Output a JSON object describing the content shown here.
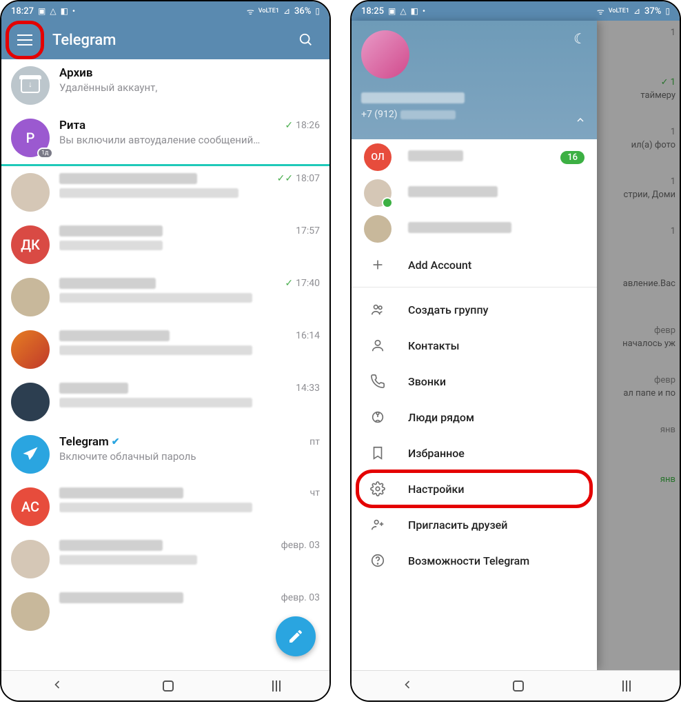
{
  "left": {
    "status": {
      "time": "18:27",
      "battery": "36%"
    },
    "header": {
      "title": "Telegram"
    },
    "chats": [
      {
        "name": "Архив",
        "msg": "Удалённый аккаунт,",
        "time": "",
        "avatar": "archive",
        "checks": 0
      },
      {
        "name": "Рита",
        "msg": "Вы включили автоудаление сообщений…",
        "time": "18:26",
        "avatar": "P",
        "avclass": "av-purple",
        "checks": 1,
        "badge1d": true
      },
      {
        "name": "",
        "msg": "",
        "time": "18:07",
        "avatar": "",
        "avclass": "av-pix",
        "checks": 2,
        "blurred": true,
        "nw": 200,
        "mw": 260
      },
      {
        "name": "",
        "msg": "",
        "time": "17:57",
        "avatar": "ДК",
        "avclass": "av-red",
        "checks": 0,
        "blurred": true,
        "nw": 150,
        "mw": 150
      },
      {
        "name": "",
        "msg": "",
        "time": "17:40",
        "avatar": "",
        "avclass": "av-pix2",
        "checks": 1,
        "blurred": true,
        "nw": 140,
        "mw": 280
      },
      {
        "name": "",
        "msg": "",
        "time": "16:14",
        "avatar": "",
        "avclass": "av-grad",
        "checks": 0,
        "blurred": true,
        "nw": 160,
        "mw": 280
      },
      {
        "name": "",
        "msg": "",
        "time": "14:33",
        "avatar": "",
        "avclass": "av-dark",
        "checks": 0,
        "blurred": true,
        "nw": 100,
        "mw": 280
      },
      {
        "name": "Telegram",
        "msg": "Включите облачный пароль",
        "time": "пт",
        "avatar": "tg",
        "avclass": "av-tg",
        "checks": 0,
        "verified": true
      },
      {
        "name": "",
        "msg": "",
        "time": "чт",
        "avatar": "АС",
        "avclass": "av-orange",
        "checks": 0,
        "blurred": true,
        "nw": 180,
        "mw": 280
      },
      {
        "name": "",
        "msg": "",
        "time": "февр. 03",
        "avatar": "",
        "avclass": "av-pix",
        "checks": 0,
        "blurred": true,
        "nw": 150,
        "mw": 200
      },
      {
        "name": "",
        "msg": "",
        "time": "февр. 03",
        "avatar": "",
        "avclass": "av-pix2",
        "checks": 0,
        "blurred": true,
        "nw": 180,
        "mw": 0
      }
    ]
  },
  "right": {
    "status": {
      "time": "18:25",
      "battery": "37%"
    },
    "phone_prefix": "+7 (912)",
    "accounts": [
      {
        "label": "",
        "avtext": "ОЛ",
        "avclass": "av-orange",
        "badge": "16",
        "blurred": true,
        "bw": 80
      },
      {
        "label": "",
        "avtext": "",
        "avclass": "av-pix",
        "blurred": true,
        "bw": 130,
        "online": true
      },
      {
        "label": "",
        "avtext": "",
        "avclass": "av-pix2",
        "blurred": true,
        "bw": 150
      }
    ],
    "add_account": "Add Account",
    "menu": [
      {
        "label": "Создать группу",
        "icon": "group"
      },
      {
        "label": "Контакты",
        "icon": "contact"
      },
      {
        "label": "Звонки",
        "icon": "call"
      },
      {
        "label": "Люди рядом",
        "icon": "nearby"
      },
      {
        "label": "Избранное",
        "icon": "bookmark"
      },
      {
        "label": "Настройки",
        "icon": "settings",
        "highlight": true
      },
      {
        "label": "Пригласить друзей",
        "icon": "invite"
      },
      {
        "label": "Возможности Telegram",
        "icon": "help"
      }
    ],
    "bg_rows": [
      {
        "time": "1",
        "txt": ""
      },
      {
        "time": "✓ 1",
        "txt": "таймеру",
        "green": true
      },
      {
        "time": "1",
        "txt": "ил(а) фото"
      },
      {
        "time": "1",
        "txt": "стрии, Доми"
      },
      {
        "time": "1",
        "txt": ""
      },
      {
        "time": "",
        "txt": "авление.Вас"
      },
      {
        "time": "февр",
        "txt": "началось уж"
      },
      {
        "time": "февр",
        "txt": "ал папе и по"
      },
      {
        "time": "янв",
        "txt": ""
      },
      {
        "time": "янв",
        "txt": "",
        "green": true
      }
    ]
  }
}
